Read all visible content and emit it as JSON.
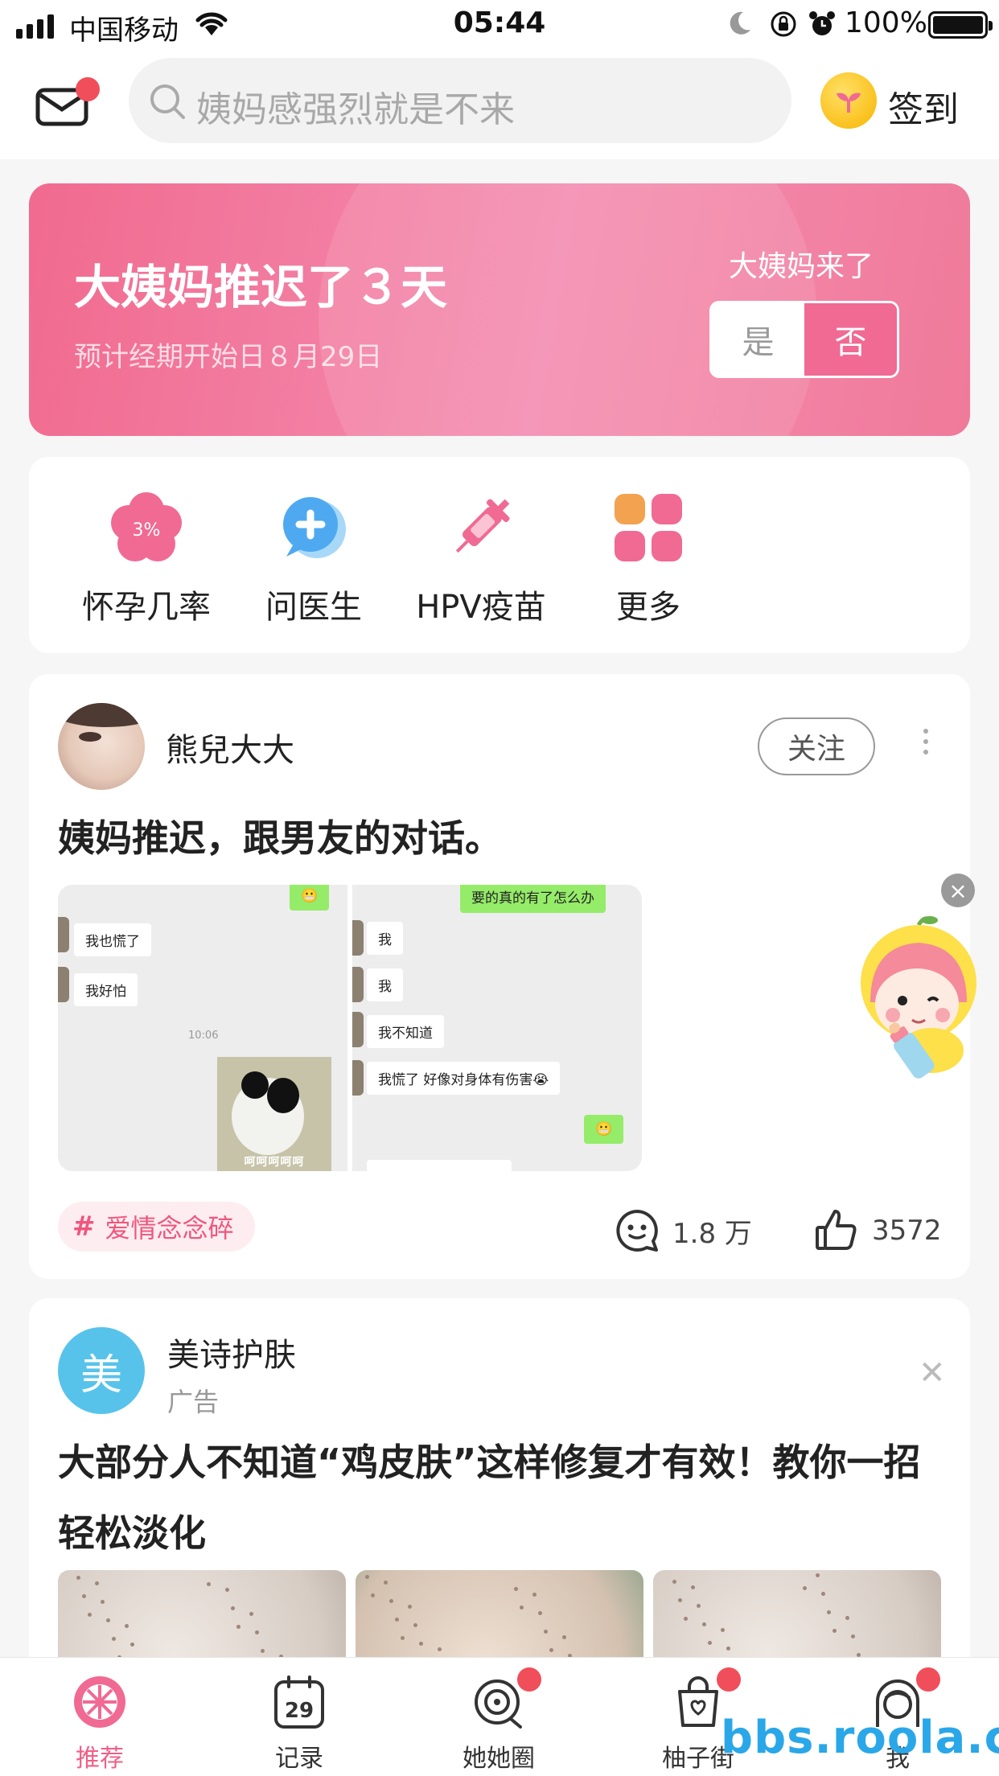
{
  "status_bar": {
    "carrier": "中国移动",
    "time": "05:44",
    "battery": "100%"
  },
  "header": {
    "search_placeholder": "姨妈感强烈就是不来",
    "checkin_label": "签到"
  },
  "period_card": {
    "title": "大姨妈推迟了３天",
    "subtitle": "预计经期开始日８月29日",
    "question": "大姨妈来了",
    "yes": "是",
    "no": "否"
  },
  "tools": [
    {
      "label": "怀孕几率",
      "icon": "pregnancy-chance-icon",
      "badge": "3%"
    },
    {
      "label": "问医生",
      "icon": "ask-doctor-icon"
    },
    {
      "label": "HPV疫苗",
      "icon": "vaccine-syringe-icon"
    },
    {
      "label": "更多",
      "icon": "more-grid-icon"
    }
  ],
  "post": {
    "author": "熊兒大大",
    "follow_label": "关注",
    "title": "姨妈推迟，跟男友的对话。",
    "image1": {
      "bubbles": [
        "我也慌了",
        "我好怕"
      ],
      "time": "10:06",
      "sticker_caption": "呵呵呵呵呵"
    },
    "image2": {
      "top_bubble": "要的真的有了怎么办",
      "bubbles": [
        "我",
        "我",
        "我不知道",
        "我慌了 好像对身体有伤害😭"
      ]
    },
    "tag": "爱情念念碎",
    "comments": "1.8 万",
    "likes": "3572"
  },
  "ad": {
    "logo_char": "美",
    "brand": "美诗护肤",
    "label": "广告",
    "title": "大部分人不知道“鸡皮肤”这样修复才有效！教你一招轻松淡化"
  },
  "tabbar": [
    {
      "label": "推荐",
      "active": true,
      "icon": "recommend-icon"
    },
    {
      "label": "记录",
      "icon": "calendar-icon",
      "date": "29"
    },
    {
      "label": "她她圈",
      "icon": "circle-community-icon",
      "dot": true
    },
    {
      "label": "柚子街",
      "icon": "shopping-bag-icon",
      "dot": true
    },
    {
      "label": "我",
      "icon": "profile-icon",
      "dot": true
    }
  ],
  "watermark": "bbs.roola.cn",
  "colors": {
    "brand_pink": "#f06a93",
    "badge_red": "#f04e5a",
    "tag_pink": "#f0567d"
  }
}
